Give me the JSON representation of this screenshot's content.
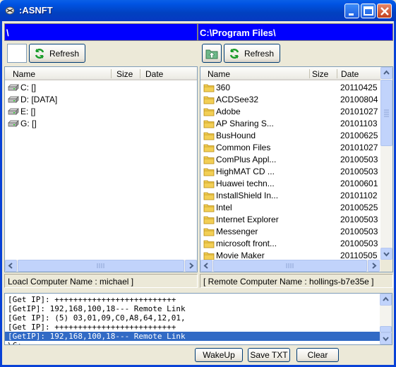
{
  "window": {
    "title": ":ASNFT"
  },
  "local": {
    "path": "\\",
    "refresh_label": "Refresh",
    "columns": {
      "name": "Name",
      "size": "Size",
      "date": "Date"
    },
    "drives": [
      {
        "name": "C: []"
      },
      {
        "name": "D: [DATA]"
      },
      {
        "name": "E: []"
      },
      {
        "name": "G: []"
      }
    ],
    "status": "Loacl Computer Name : michael ]"
  },
  "remote": {
    "path": "C:\\Program Files\\",
    "refresh_label": "Refresh",
    "columns": {
      "name": "Name",
      "size": "Size",
      "date": "Date"
    },
    "folders": [
      {
        "name": "360",
        "date": "20110425"
      },
      {
        "name": "ACDSee32",
        "date": "20100804"
      },
      {
        "name": "Adobe",
        "date": "20101027"
      },
      {
        "name": "AP Sharing S...",
        "date": "20101103"
      },
      {
        "name": "BusHound",
        "date": "20100625"
      },
      {
        "name": "Common Files",
        "date": "20101027"
      },
      {
        "name": "ComPlus Appl...",
        "date": "20100503"
      },
      {
        "name": "HighMAT CD ...",
        "date": "20100503"
      },
      {
        "name": "Huawei techn...",
        "date": "20100601"
      },
      {
        "name": "InstallShield In...",
        "date": "20101102"
      },
      {
        "name": "Intel",
        "date": "20100525"
      },
      {
        "name": "Internet Explorer",
        "date": "20100503"
      },
      {
        "name": "Messenger",
        "date": "20100503"
      },
      {
        "name": "microsoft front...",
        "date": "20100503"
      },
      {
        "name": "Movie Maker",
        "date": "20110505"
      }
    ],
    "status": "[ Remote Computer Name : hollings-b7e35e ]"
  },
  "log": {
    "lines": [
      "[Get IP]: ++++++++++++++++++++++++++",
      "[GetIP]: 192,168,100,18--- Remote Link",
      "[Get IP]: (5) 03,01,09,C0,A8,64,12,01,",
      "[Get IP]: ++++++++++++++++++++++++++",
      "[GetIP]: 192,168,100,18--- Remote Link",
      "\\C:"
    ],
    "selected_index": 4
  },
  "buttons": {
    "wakeup": "WakeUp",
    "save": "Save TXT",
    "clear": "Clear"
  }
}
